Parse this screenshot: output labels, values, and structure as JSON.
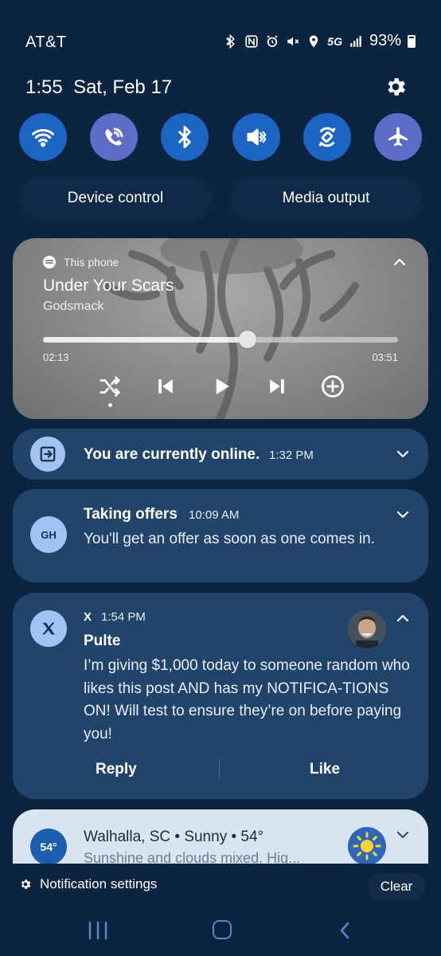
{
  "status_bar": {
    "carrier": "AT&T",
    "network": "5G",
    "battery": "93%",
    "icons": [
      "bluetooth-icon",
      "nfc-icon",
      "alarm-icon",
      "mute-icon",
      "location-icon",
      "5g-icon",
      "signal-icon",
      "battery-icon"
    ]
  },
  "header": {
    "clock": "1:55",
    "date": "Sat, Feb 17",
    "settings_icon": "gear-icon"
  },
  "quick_toggles": [
    {
      "name": "wifi",
      "icon": "wifi-icon",
      "active": true
    },
    {
      "name": "wifi-calling",
      "icon": "wifi-calling-icon",
      "active": true
    },
    {
      "name": "bluetooth",
      "icon": "bluetooth-icon",
      "active": true
    },
    {
      "name": "sound",
      "icon": "mute-icon",
      "active": true
    },
    {
      "name": "auto-rotate",
      "icon": "rotate-icon",
      "active": true
    },
    {
      "name": "airplane-mode",
      "icon": "airplane-icon",
      "active": true
    }
  ],
  "buttons": {
    "device_control": "Device control",
    "media_output": "Media output"
  },
  "media": {
    "source": "This phone",
    "title": "Under Your Scars",
    "artist": "Godsmack",
    "elapsed": "02:13",
    "total": "03:51",
    "progress": 0.576
  },
  "notifications": {
    "online": {
      "title": "You are currently online.",
      "time": "1:32 PM"
    },
    "offers": {
      "app_badge": "GH",
      "title": "Taking offers",
      "time": "10:09 AM",
      "body": "You'll get an offer as soon as one comes in."
    },
    "x_post": {
      "app": "X",
      "time": "1:54 PM",
      "sender": "Pulte",
      "body": "I’m giving $1,000 today to someone random who likes this post AND has my NOTIFICA-TIONS ON! Will test to ensure they’re on before paying you!",
      "reply_label": "Reply",
      "like_label": "Like"
    },
    "weather": {
      "temp_badge": "54°",
      "title": "Walhalla, SC • Sunny • 54°",
      "body": "Sunshine and clouds mixed. Hig..."
    }
  },
  "footer": {
    "notification_settings": "Notification settings",
    "clear": "Clear"
  }
}
